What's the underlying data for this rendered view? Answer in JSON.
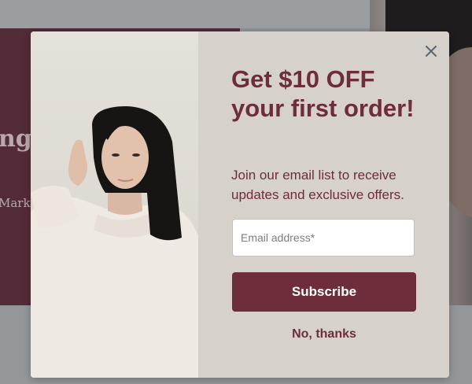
{
  "background_page": {
    "hero_title_fragment": "ng",
    "hero_text_fragment": "Marke"
  },
  "popup": {
    "title": "Get $10 OFF your first order!",
    "description": "Join our email list to receive updates and exclusive offers.",
    "email_placeholder": "Email address*",
    "email_value": "",
    "subscribe_label": "Subscribe",
    "decline_label": "No, thanks",
    "close_icon": "close-icon",
    "colors": {
      "accent": "#6d2d3b",
      "panel_bg": "#d6d1cb",
      "overlay_hero": "#542b38"
    }
  }
}
